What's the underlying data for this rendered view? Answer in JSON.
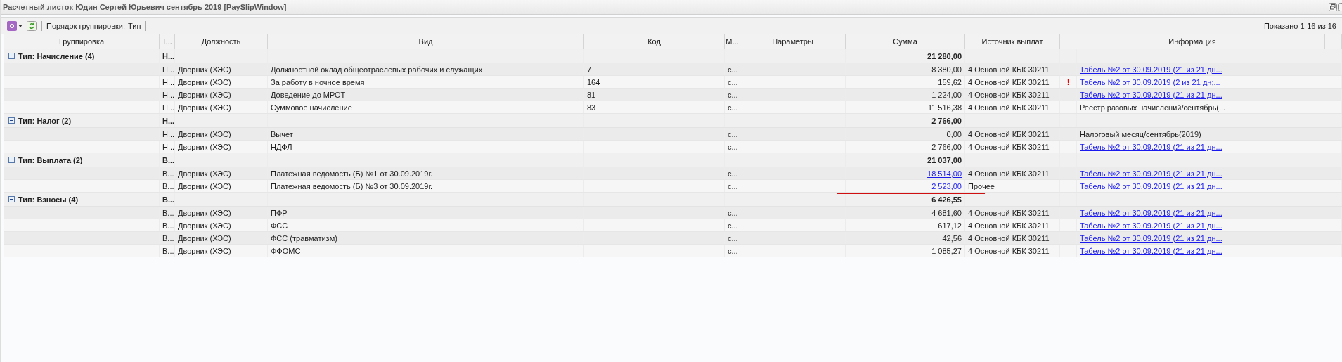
{
  "window": {
    "title": "Расчетный листок Юдин Сергей Юрьевич сентябрь 2019 [PaySlipWindow]"
  },
  "toolbar": {
    "grouping_label": "Порядок группировки:",
    "grouping_value": "Тип",
    "paging": "Показано 1-16 из 16"
  },
  "columns": [
    "Группировка",
    "Т...",
    "Должность",
    "Вид",
    "Код",
    "М...",
    "Параметры",
    "Сумма",
    "Источник выплат",
    "Информация"
  ],
  "groups": [
    {
      "label": "Тип: Начисление (4)",
      "type": "Н...",
      "total": "21 280,00",
      "expanded": true,
      "rows": [
        {
          "type": "Н...",
          "position": "Дворник (ХЭС)",
          "kind_name": "Должностной оклад общеотраслевых рабочих и служащих",
          "code": "7",
          "m": "с...",
          "sum": "8 380,00",
          "sum_link": false,
          "source": "4 Основной КБК 30211",
          "info": "Табель №2 от 30.09.2019 (21 из 21 дн...",
          "info_link": true,
          "marked": false
        },
        {
          "type": "Н...",
          "position": "Дворник (ХЭС)",
          "kind_name": "За работу в ночное время",
          "code": "164",
          "m": "с...",
          "sum": "159,62",
          "sum_link": false,
          "source": "4 Основной КБК 30211",
          "flag": "!",
          "info": "Табель №2 от 30.09.2019 (2 из 21 дн;...",
          "info_link": true,
          "marked": false
        },
        {
          "type": "Н...",
          "position": "Дворник (ХЭС)",
          "kind_name": "Доведение до МРОТ",
          "code": "81",
          "m": "с...",
          "sum": "1 224,00",
          "sum_link": false,
          "source": "4 Основной КБК 30211",
          "info": "Табель №2 от 30.09.2019 (21 из 21 дн...",
          "info_link": true,
          "marked": false
        },
        {
          "type": "Н...",
          "position": "Дворник (ХЭС)",
          "kind_name": "Суммовое начисление",
          "code": "83",
          "m": "с...",
          "sum": "11 516,38",
          "sum_link": false,
          "source": "4 Основной КБК 30211",
          "info": "Реестр разовых начислений/сентябрь(...",
          "info_link": false,
          "marked": false
        }
      ]
    },
    {
      "label": "Тип: Налог (2)",
      "type": "Н...",
      "total": "2 766,00",
      "expanded": true,
      "rows": [
        {
          "type": "Н...",
          "position": "Дворник (ХЭС)",
          "kind_name": "Вычет",
          "m": "с...",
          "sum": "0,00",
          "sum_link": false,
          "source": "4 Основной КБК 30211",
          "info": "Налоговый месяц/сентябрь(2019)",
          "info_link": false,
          "marked": false
        },
        {
          "type": "Н...",
          "position": "Дворник (ХЭС)",
          "kind_name": "НДФЛ",
          "m": "с...",
          "sum": "2 766,00",
          "sum_link": false,
          "source": "4 Основной КБК 30211",
          "info": "Табель №2 от 30.09.2019 (21 из 21 дн...",
          "info_link": true,
          "marked": false
        }
      ]
    },
    {
      "label": "Тип: Выплата (2)",
      "type": "В...",
      "total": "21 037,00",
      "expanded": true,
      "rows": [
        {
          "type": "В...",
          "position": "Дворник (ХЭС)",
          "kind_name": "Платежная ведомость (Б) №1 от 30.09.2019г.",
          "m": "с...",
          "sum": "18 514,00",
          "sum_link": true,
          "source": "4 Основной КБК 30211",
          "info": "Табель №2 от 30.09.2019 (21 из 21 дн...",
          "info_link": true,
          "marked": false
        },
        {
          "type": "В...",
          "position": "Дворник (ХЭС)",
          "kind_name": "Платежная ведомость (Б) №3 от 30.09.2019г.",
          "m": "с...",
          "sum": "2 523,00",
          "sum_link": true,
          "source": "Прочее",
          "info": "Табель №2 от 30.09.2019 (21 из 21 дн...",
          "info_link": true,
          "marked": true
        }
      ]
    },
    {
      "label": "Тип: Взносы (4)",
      "type": "В...",
      "total": "6 426,55",
      "expanded": true,
      "rows": [
        {
          "type": "В...",
          "position": "Дворник (ХЭС)",
          "kind_name": "ПФР",
          "m": "с...",
          "sum": "4 681,60",
          "sum_link": false,
          "source": "4 Основной КБК 30211",
          "info": "Табель №2 от 30.09.2019 (21 из 21 дн...",
          "info_link": true,
          "marked": false
        },
        {
          "type": "В...",
          "position": "Дворник (ХЭС)",
          "kind_name": "ФСС",
          "m": "с...",
          "sum": "617,12",
          "sum_link": false,
          "source": "4 Основной КБК 30211",
          "info": "Табель №2 от 30.09.2019 (21 из 21 дн...",
          "info_link": true,
          "marked": false
        },
        {
          "type": "В...",
          "position": "Дворник (ХЭС)",
          "kind_name": "ФСС (травматизм)",
          "m": "с...",
          "sum": "42,56",
          "sum_link": false,
          "source": "4 Основной КБК 30211",
          "info": "Табель №2 от 30.09.2019 (21 из 21 дн...",
          "info_link": true,
          "marked": false
        },
        {
          "type": "В...",
          "position": "Дворник (ХЭС)",
          "kind_name": "ФФОМС",
          "m": "с...",
          "sum": "1 085,27",
          "sum_link": false,
          "source": "4 Основной КБК 30211",
          "info": "Табель №2 от 30.09.2019 (21 из 21 дн...",
          "info_link": true,
          "marked": false
        }
      ]
    }
  ]
}
